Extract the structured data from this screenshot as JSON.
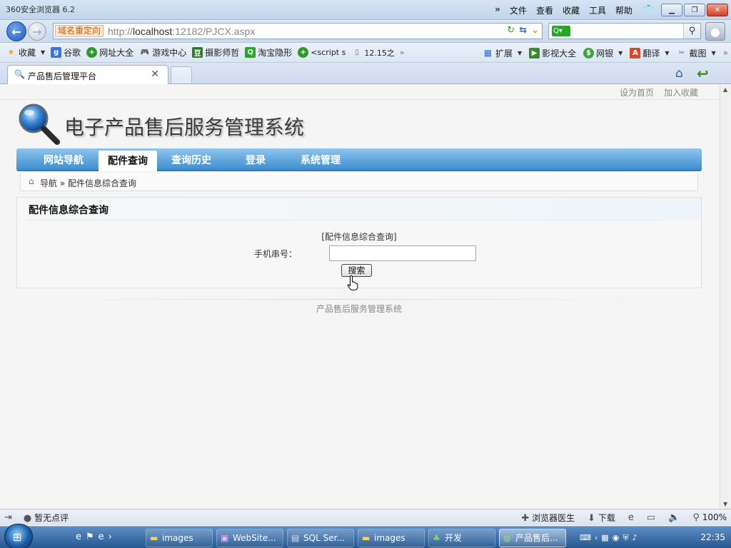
{
  "browser": {
    "app_title": "360安全浏览器 6.2",
    "menus": [
      "文件",
      "查看",
      "收藏",
      "工具",
      "帮助"
    ],
    "address": {
      "redirect_badge": "域名重定向",
      "url_prefix": "http://",
      "url_host": "localhost",
      "url_rest": ":12182/PJCX.aspx"
    },
    "search": {
      "placeholder": ""
    },
    "favorites": [
      {
        "label": "收藏",
        "icon": "star-icon"
      },
      {
        "label": "谷歌",
        "icon": "google-icon"
      },
      {
        "label": "网址大全",
        "icon": "plus-icon"
      },
      {
        "label": "游戏中心",
        "icon": "gamepad-icon"
      },
      {
        "label": "摄影师哲",
        "icon": "douban-icon"
      },
      {
        "label": "淘宝隐形",
        "icon": "search-icon"
      },
      {
        "label": "<script s",
        "icon": "plus-icon"
      },
      {
        "label": "12.15之",
        "icon": "page-icon"
      }
    ],
    "toolbar_right": [
      {
        "label": "扩展",
        "icon": "grid-icon"
      },
      {
        "label": "影视大全",
        "icon": "play-icon"
      },
      {
        "label": "网银",
        "icon": "shield-icon"
      },
      {
        "label": "翻译",
        "icon": "translate-icon"
      },
      {
        "label": "截图",
        "icon": "scissors-icon"
      }
    ],
    "tab": {
      "label": "产品售后管理平台"
    },
    "status": {
      "comment": "暂无点评",
      "doctor": "浏览器医生",
      "download": "下载",
      "zoom": "100%"
    }
  },
  "page": {
    "top_links": [
      "设为首页",
      "加入收藏"
    ],
    "site_title": "电子产品售后服务管理系统",
    "nav": [
      {
        "label": "网站导航",
        "active": false
      },
      {
        "label": "配件查询",
        "active": true
      },
      {
        "label": "查询历史",
        "active": false
      },
      {
        "label": "登录",
        "active": false
      },
      {
        "label": "系统管理",
        "active": false
      }
    ],
    "breadcrumb": "导航 » 配件信息综合查询",
    "panel": {
      "title": "配件信息综合查询",
      "caption": "[配件信息综合查询]",
      "field_label": "手机串号：",
      "field_value": "",
      "button": "搜索"
    },
    "footer": "产品售后服务管理系统"
  },
  "taskbar": {
    "items": [
      {
        "label": "images",
        "icon": "folder-icon"
      },
      {
        "label": "WebSite...",
        "icon": "vs-icon"
      },
      {
        "label": "SQL Ser...",
        "icon": "sql-icon"
      },
      {
        "label": "images",
        "icon": "folder-icon"
      },
      {
        "label": "开发",
        "icon": "tree-icon"
      },
      {
        "label": "产品售后...",
        "icon": "browser-icon"
      }
    ],
    "clock": "22:35"
  }
}
